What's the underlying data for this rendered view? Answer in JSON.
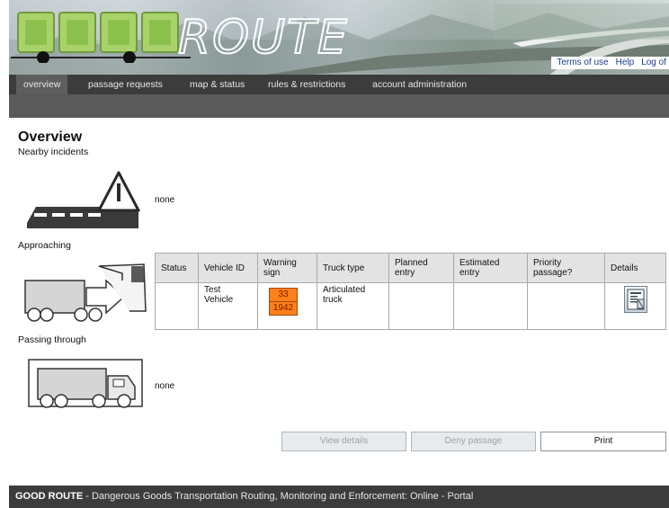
{
  "top_links": [
    "Terms of use",
    "Help",
    "Log of"
  ],
  "nav": {
    "items": [
      "overview",
      "passage requests",
      "map & status",
      "rules & restrictions",
      "account administration"
    ],
    "active": "overview"
  },
  "page_title": "Overview",
  "sections": {
    "nearby_incidents": "Nearby incidents",
    "nearby_value": "none",
    "approaching": "Approaching",
    "passing_through": "Passing through",
    "passing_value": "none"
  },
  "table": {
    "headers": [
      "Status",
      "Vehicle ID",
      "Warning sign",
      "Truck type",
      "Planned entry",
      "Estimated entry",
      "Priority passage?",
      "Details"
    ],
    "row": {
      "status": "",
      "vehicle_id": "Test Vehicle",
      "warning_top": "33",
      "warning_bottom": "1942",
      "truck_type": "Articulated truck",
      "planned_entry": "",
      "estimated_entry": "",
      "priority": ""
    }
  },
  "buttons": {
    "view_details": "View details",
    "deny_passage": "Deny passage",
    "print": "Print"
  },
  "footer": {
    "brand": "GOOD ROUTE",
    "text": " - Dangerous Goods Transportation Routing, Monitoring and Enforcement: Online - Portal"
  },
  "icons": [
    "warning-triangle-icon",
    "truck-approaching-icon",
    "truck-passing-icon",
    "details-document-icon"
  ],
  "colors": {
    "warning_sign": "#ff7f18",
    "nav_bg": "#3c3c3c",
    "link": "#1b3d8a"
  }
}
